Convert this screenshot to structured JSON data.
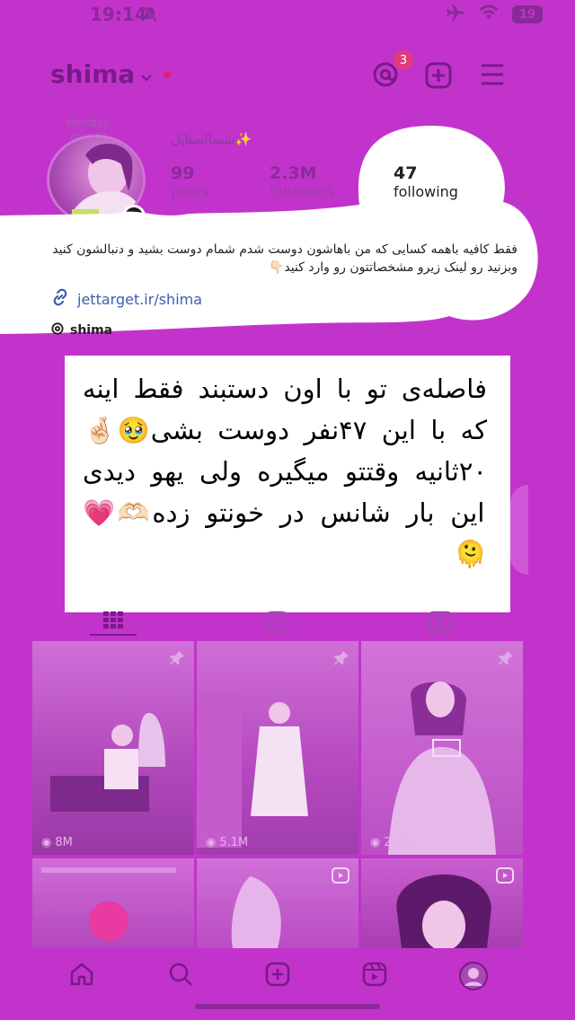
{
  "status": {
    "time": "19:14",
    "battery": "19"
  },
  "header": {
    "username": "shima",
    "threads_badge": "3"
  },
  "profile": {
    "note": "Monday mood?",
    "display_name": "شیمااستایل✨",
    "posts_count": "99",
    "posts_label": "posts",
    "followers_count": "2.3M",
    "followers_label": "followers",
    "following_count": "47",
    "following_label": "following",
    "bio": "فقط کافیه باهمه کسایی که من باهاشون دوست شدم شمام دوست بشید و دنبالشون کنید وبزنید رو لینک زیرو مشخصاتتون رو وارد کنید👇🏻",
    "link": "jettarget.ir/shima",
    "threads_handle": "shima"
  },
  "caption": "فاصله‌ی تو با اون دستبند فقط اینه که با این ۴۷نفر دوست بشی🥹🤞🏻 ۲۰ثانیه وقتتو میگیره ولی یهو دیدی این بار شانس در خونتو زده🫶🏻💗🫠",
  "grid": [
    {
      "views": "8M",
      "pinned": true
    },
    {
      "views": "5.1M",
      "pinned": true
    },
    {
      "views": "2.7M",
      "pinned": true
    },
    {
      "views": "",
      "pinned": false
    },
    {
      "views": "",
      "pinned": false,
      "reel": true
    },
    {
      "views": "",
      "pinned": false,
      "reel": true
    }
  ]
}
